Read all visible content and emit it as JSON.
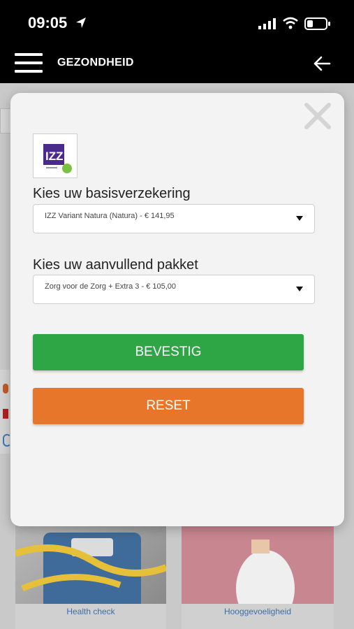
{
  "status_bar": {
    "time": "09:05",
    "icons": [
      "location-arrow-icon",
      "cellular-signal-icon",
      "wifi-icon",
      "battery-icon"
    ]
  },
  "header": {
    "title": "GEZONDHEID",
    "menu_icon": "hamburger-menu-icon",
    "back_icon": "back-arrow-icon"
  },
  "background_cards": [
    {
      "label": "Health check"
    },
    {
      "label": "Hooggevoeligheid"
    }
  ],
  "modal": {
    "close_icon": "close-x-icon",
    "logo": "izz-logo",
    "basis": {
      "label": "Kies uw basisverzekering",
      "selected": "IZZ Variant Natura (Natura)  - € 141,95"
    },
    "aanvullend": {
      "label": "Kies uw aanvullend pakket",
      "selected": "Zorg voor de Zorg + Extra 3  - € 105,00"
    },
    "confirm_label": "BEVESTIG",
    "reset_label": "RESET"
  },
  "colors": {
    "confirm": "#2fa646",
    "reset": "#e8762a",
    "header_bg": "#000000",
    "modal_bg": "#f3f3f3",
    "link_blue": "#3d6fa7"
  }
}
